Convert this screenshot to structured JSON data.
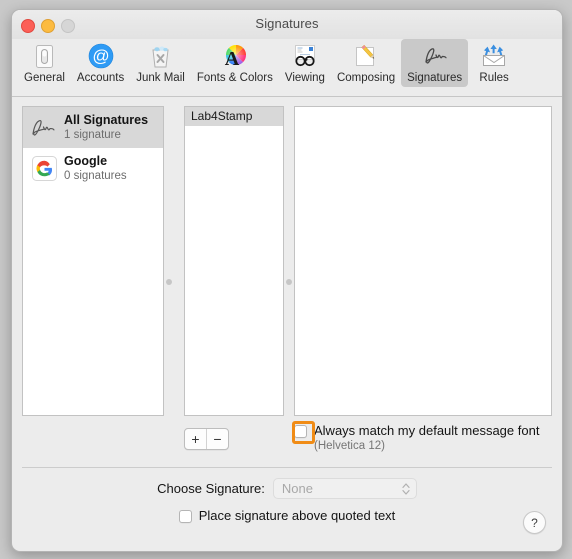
{
  "window": {
    "title": "Signatures",
    "traffic_lights": [
      "close",
      "minimize",
      "zoom"
    ]
  },
  "toolbar": {
    "items": [
      {
        "label": "General",
        "icon": "general-switch-icon",
        "selected": false
      },
      {
        "label": "Accounts",
        "icon": "at-sign-icon",
        "selected": false
      },
      {
        "label": "Junk Mail",
        "icon": "trash-can-icon",
        "selected": false
      },
      {
        "label": "Fonts & Colors",
        "icon": "font-color-wheel-icon",
        "selected": false
      },
      {
        "label": "Viewing",
        "icon": "eyeglasses-icon",
        "selected": false
      },
      {
        "label": "Composing",
        "icon": "pencil-notepad-icon",
        "selected": false
      },
      {
        "label": "Signatures",
        "icon": "signature-icon",
        "selected": true
      },
      {
        "label": "Rules",
        "icon": "envelope-arrows-icon",
        "selected": false
      }
    ]
  },
  "accounts_pane": {
    "rows": [
      {
        "name": "All Signatures",
        "sub": "1 signature",
        "icon": "signature-squiggle-icon",
        "selected": true
      },
      {
        "name": "Google",
        "sub": "0 signatures",
        "icon": "google-g-icon",
        "selected": false
      }
    ]
  },
  "signature_list_pane": {
    "rows": [
      {
        "name": "Lab4Stamp",
        "selected": true
      }
    ]
  },
  "preview_pane": {
    "content": ""
  },
  "list_controls": {
    "add_label": "+",
    "remove_label": "−"
  },
  "match_font": {
    "label": "Always match my default message font",
    "sublabel": "(Helvetica 12)",
    "checked": false,
    "highlight_color": "#f08c16"
  },
  "choose_signature": {
    "label": "Choose Signature:",
    "value": "None",
    "enabled": false,
    "options": [
      "None"
    ]
  },
  "place_signature": {
    "label": "Place signature above quoted text",
    "checked": false
  },
  "help": {
    "label": "?"
  }
}
